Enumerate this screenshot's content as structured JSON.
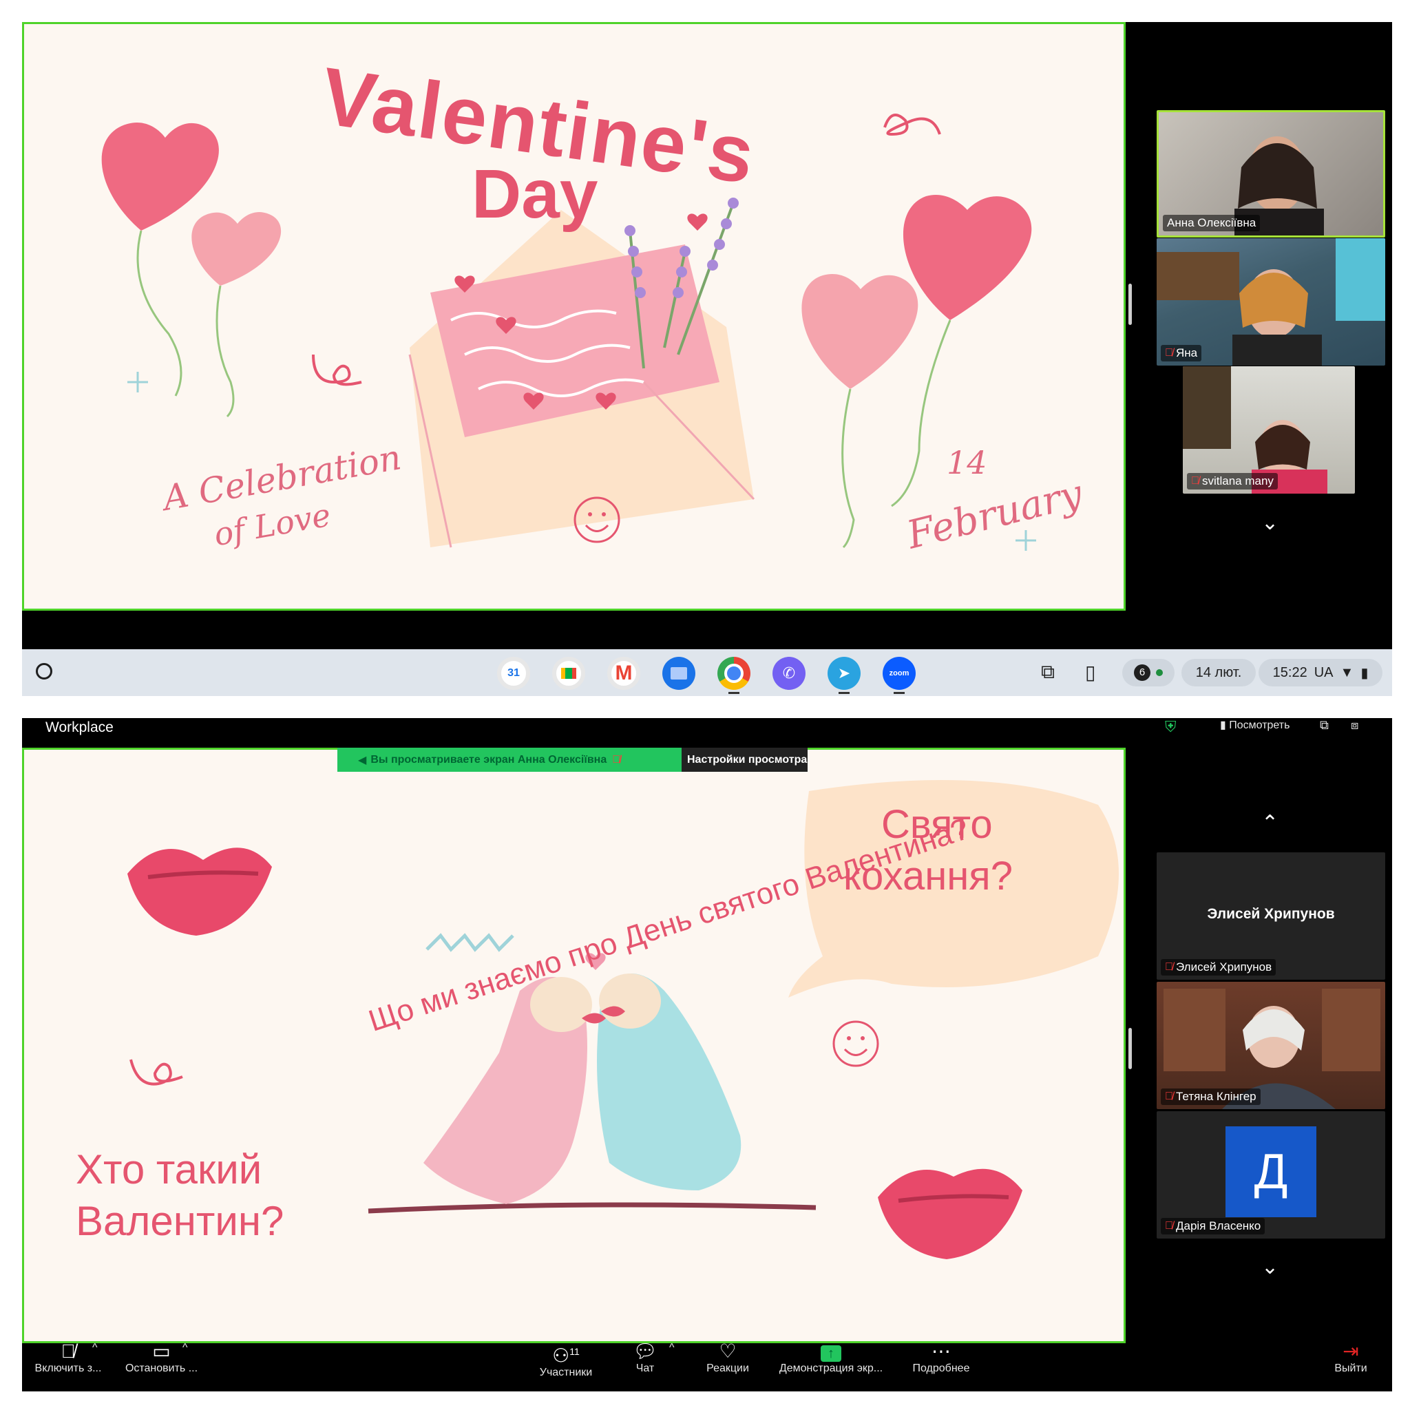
{
  "top": {
    "slide": {
      "title_line1": "Valentine's",
      "title_line2": "Day",
      "tagline_line1": "A Celebration",
      "tagline_line2": "of Love",
      "date_day": "14",
      "date_month": "February"
    },
    "participants": [
      {
        "name": "Анна Олексіївна",
        "muted": false,
        "active": true
      },
      {
        "name": "Яна",
        "muted": true
      },
      {
        "name": "svitlana many",
        "muted": true
      }
    ],
    "shelf": {
      "apps": [
        "calendar-icon",
        "meet-icon",
        "gmail-icon",
        "files-icon",
        "chrome-icon",
        "viber-icon",
        "telegram-icon",
        "zoom-icon"
      ],
      "zoom_label": "zoom",
      "calendar_label": "31",
      "notification_count": "6",
      "date": "14 лют.",
      "time": "15:22",
      "region": "UA"
    }
  },
  "bottom": {
    "app_title": "Workplace",
    "share_banner": {
      "text": "Вы просматриваете экран  Анна Олексіївна",
      "settings": "Настройки просмотра"
    },
    "view_label": "Посмотреть",
    "slide": {
      "arc_text": "Що ми знаємо про День святого Валентина?",
      "bubble_line1": "Свято",
      "bubble_line2": "кохання?",
      "question_line1": "Хто такий",
      "question_line2": "Валентин?"
    },
    "participants": [
      {
        "name": "Элисей Хрипунов",
        "muted": true,
        "camera_off": true
      },
      {
        "name": "Тетяна Клінгер",
        "muted": true
      },
      {
        "name": "Дарія Власенко",
        "muted": true,
        "initial": "Д"
      }
    ],
    "toolbar": {
      "mic": "Включить з...",
      "video": "Остановить ...",
      "participants": "Участники",
      "participants_count": "11",
      "chat": "Чат",
      "reactions": "Реакции",
      "share": "Демонстрация экр...",
      "more": "Подробнее",
      "leave": "Выйти"
    },
    "colors": {
      "share_green": "#22c55e",
      "leave_red": "#e02424",
      "accent_pink": "#e5556f"
    }
  }
}
